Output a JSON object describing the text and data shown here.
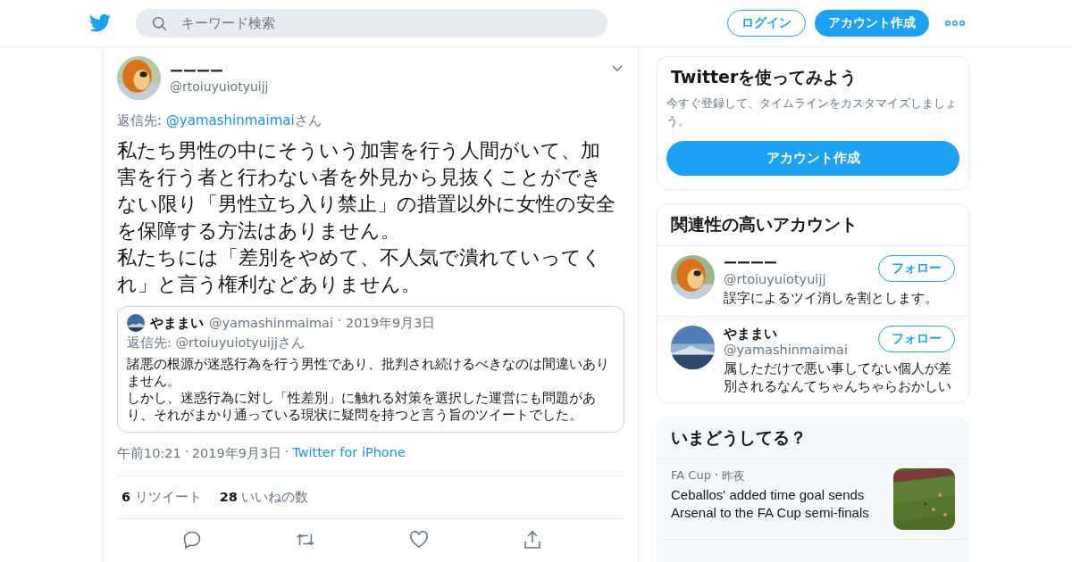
{
  "header": {
    "search": {
      "placeholder": "キーワード検索"
    },
    "login": "ログイン",
    "signup": "アカウント作成"
  },
  "tweet": {
    "name": "ーーーー",
    "handle": "@rtoiuyuiotyuijj",
    "reply_to": {
      "prefix": "返信先: ",
      "handle": "@yamashinmaimai",
      "suffix": "さん"
    },
    "text": [
      "私たち男性の中にそういう加害を行う人間がいて、加害を行う者と行わない者を外見から見抜くことができない限り「男性立ち入り禁止」の措置以外に女性の安全を保障する方法はありません。",
      "私たちには「差別をやめて、不人気で潰れていってくれ」と言う権利などありません。"
    ],
    "quote": {
      "name": "やままい",
      "handle": "@yamashinmaimai",
      "date": "2019年9月3日",
      "reply_to": "返信先: @rtoiuyuiotyuijjさん",
      "text": [
        "諸悪の根源が迷惑行為を行う男性であり、批判され続けるべきなのは間違いありません。",
        "しかし、迷惑行為に対し「性差別」に触れる対策を選択した運営にも問題があり、それがまかり通っている現状に疑問を持つと言う旨のツイートでした。"
      ]
    },
    "time": "午前10:21",
    "date": "2019年9月3日",
    "source": "Twitter for iPhone",
    "stats": [
      {
        "count": "6",
        "label": "リツイート"
      },
      {
        "count": "28",
        "label": "いいねの数"
      }
    ]
  },
  "signup_card": {
    "title": "Twitterを使ってみよう",
    "text": "今すぐ登録して、タイムラインをカスタマイズしましょう。",
    "button": "アカウント作成"
  },
  "related": {
    "title": "関連性の高いアカウント",
    "accounts": [
      {
        "name": "ーーーー",
        "handle": "@rtoiuyuiotyuijj",
        "bio": "誤字によるツイ消しを割とします。",
        "button": "フォロー"
      },
      {
        "name": "やままい",
        "handle": "@yamashinmaimai",
        "bio": "属しただけで悪い事してない個人が差別されるなんてちゃんちゃらおかしい",
        "button": "フォロー"
      }
    ]
  },
  "trends": {
    "title": "いまどうしてる？",
    "items": [
      {
        "category": "FA Cup",
        "time": "昨夜",
        "headline": "Ceballos' added time goal sends Arsenal to the FA Cup semi-finals",
        "kind": "picture"
      }
    ]
  }
}
